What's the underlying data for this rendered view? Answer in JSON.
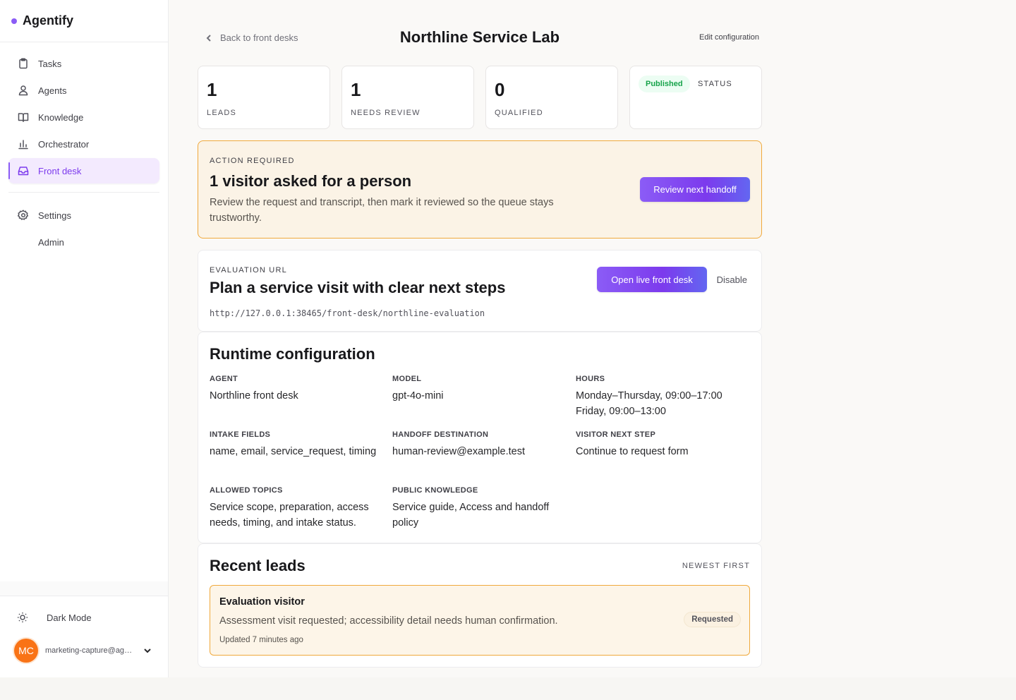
{
  "brand": {
    "name": "Agentify",
    "accent": "#8b5cf6"
  },
  "sidebar": {
    "items": [
      {
        "label": "Tasks",
        "icon": "clipboard-icon"
      },
      {
        "label": "Agents",
        "icon": "user-icon"
      },
      {
        "label": "Knowledge",
        "icon": "book-icon"
      },
      {
        "label": "Orchestrator",
        "icon": "bar-chart-icon"
      },
      {
        "label": "Front desk",
        "icon": "inbox-icon",
        "active": true
      }
    ],
    "settings_label": "Settings",
    "admin_label": "Admin",
    "dark_mode_label": "Dark Mode",
    "user": {
      "initials": "MC",
      "email": "marketing-capture@agentify.test"
    }
  },
  "header": {
    "back_label": "Back to front desks",
    "title": "Northline Service Lab",
    "edit_label": "Edit configuration"
  },
  "stats": [
    {
      "value": "1",
      "label": "LEADS"
    },
    {
      "value": "1",
      "label": "NEEDS REVIEW"
    },
    {
      "value": "0",
      "label": "QUALIFIED"
    }
  ],
  "status": {
    "badge": "Published",
    "label": "STATUS",
    "color": "#16a34a"
  },
  "alert": {
    "kicker": "ACTION REQUIRED",
    "title": "1 visitor asked for a person",
    "description": "Review the request and transcript, then mark it reviewed so the queue stays trustworthy.",
    "button": "Review next handoff",
    "border_color": "#f0a93c"
  },
  "evaluation": {
    "kicker": "EVALUATION URL",
    "title": "Plan a service visit with clear next steps",
    "url": "http://127.0.0.1:38465/front-desk/northline-evaluation",
    "open_button": "Open live front desk",
    "disable_button": "Disable"
  },
  "runtime": {
    "title": "Runtime configuration",
    "agent_label": "AGENT",
    "agent_value": "Northline front desk",
    "model_label": "MODEL",
    "model_value": "gpt-4o-mini",
    "hours_label": "HOURS",
    "hours_line1": "Monday–Thursday, 09:00–17:00",
    "hours_line2": "Friday, 09:00–13:00",
    "intake_label": "INTAKE FIELDS",
    "intake_value": "name, email, service_request, timing",
    "handoff_label": "HANDOFF DESTINATION",
    "handoff_value": "human-review@example.test",
    "next_step_label": "VISITOR NEXT STEP",
    "next_step_value": "Continue to request form",
    "topics_label": "ALLOWED TOPICS",
    "topics_value": "Service scope, preparation, access needs, timing, and intake status.",
    "knowledge_label": "PUBLIC KNOWLEDGE",
    "knowledge_value": "Service guide, Access and handoff policy"
  },
  "leads": {
    "title": "Recent leads",
    "sort_label": "NEWEST FIRST",
    "items": [
      {
        "name": "Evaluation visitor",
        "description": "Assessment visit requested; accessibility detail needs human confirmation.",
        "updated": "Updated 7 minutes ago",
        "status": "Requested"
      }
    ]
  }
}
